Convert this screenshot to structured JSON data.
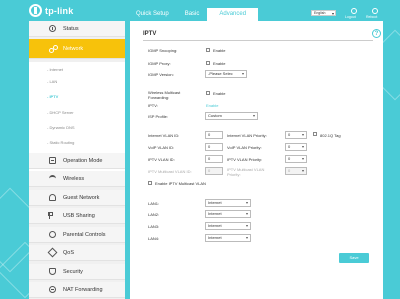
{
  "brand": {
    "logo_text": "tp-link"
  },
  "header": {
    "tabs": [
      {
        "label": "Quick Setup",
        "active": false
      },
      {
        "label": "Basic",
        "active": false
      },
      {
        "label": "Advanced",
        "active": true
      }
    ],
    "language": "English",
    "logout_label": "Logout",
    "reboot_label": "Reboot"
  },
  "sidebar": {
    "items": [
      {
        "label": "Status",
        "icon": "info-icon"
      },
      {
        "label": "Network",
        "icon": "network-icon",
        "active": true
      },
      {
        "label": "Operation Mode",
        "icon": "operation-mode-icon"
      },
      {
        "label": "Wireless",
        "icon": "wifi-icon"
      },
      {
        "label": "Guest Network",
        "icon": "guest-icon"
      },
      {
        "label": "USB Sharing",
        "icon": "usb-icon"
      },
      {
        "label": "Parental Controls",
        "icon": "parental-icon"
      },
      {
        "label": "QoS",
        "icon": "qos-icon"
      },
      {
        "label": "Security",
        "icon": "shield-icon"
      },
      {
        "label": "NAT Forwarding",
        "icon": "nat-icon"
      }
    ],
    "subitems": [
      {
        "label": "- Internet"
      },
      {
        "label": "- LAN"
      },
      {
        "label": "- IPTV",
        "active": true
      },
      {
        "label": "- DHCP Server"
      },
      {
        "label": "- Dynamic DNS"
      },
      {
        "label": "- Static Routing"
      }
    ]
  },
  "main": {
    "title": "IPTV",
    "help_label": "?",
    "igmp_snooping": {
      "label": "IGMP Snooping:",
      "cb_label": "Enable"
    },
    "igmp_proxy": {
      "label": "IGMP Proxy:",
      "cb_label": "Enable"
    },
    "igmp_version": {
      "label": "IGMP Version:",
      "value": "-Please Selec"
    },
    "wireless_multicast": {
      "label1": "Wireless Multicast",
      "label2": "Forwarding:",
      "cb_label": "Enable"
    },
    "iptv": {
      "label": "IPTV:",
      "link": "Enable"
    },
    "isp_profile": {
      "label": "ISP Profile:",
      "value": "Custom"
    },
    "internet_vlan_id": {
      "label": "Internet VLAN ID:",
      "value": "0"
    },
    "internet_vlan_priority": {
      "label": "Internet VLAN Priority:",
      "value": "0"
    },
    "tag_8021q": {
      "cb_label": "802.1Q Tag"
    },
    "voip_vlan_id": {
      "label": "VoIP VLAN ID:",
      "value": "0"
    },
    "voip_vlan_priority": {
      "label": "VoIP VLAN Priority:",
      "value": "0"
    },
    "iptv_vlan_id": {
      "label": "IPTV VLAN ID:",
      "value": "0"
    },
    "iptv_vlan_priority": {
      "label": "IPTV VLAN Priority:",
      "value": "0"
    },
    "iptv_multicast_vlan_id": {
      "label1": "IPTV Multicast VLAN ID:",
      "value": "0"
    },
    "iptv_multicast_vlan_priority": {
      "label1": "IPTV Multicast VLAN",
      "label2": "Priority:",
      "value": "0"
    },
    "enable_iptv_multicast_vlan": {
      "cb_label": "Enable IPTV Multicast VLAN"
    },
    "lans": [
      {
        "label": "LAN1:",
        "value": "Internet"
      },
      {
        "label": "LAN2:",
        "value": "Internet"
      },
      {
        "label": "LAN3:",
        "value": "Internet"
      },
      {
        "label": "LAN4:",
        "value": "Internet"
      }
    ],
    "save_label": "Save"
  },
  "colors": {
    "accent": "#4acbd6",
    "active_nav": "#f7c20b"
  }
}
